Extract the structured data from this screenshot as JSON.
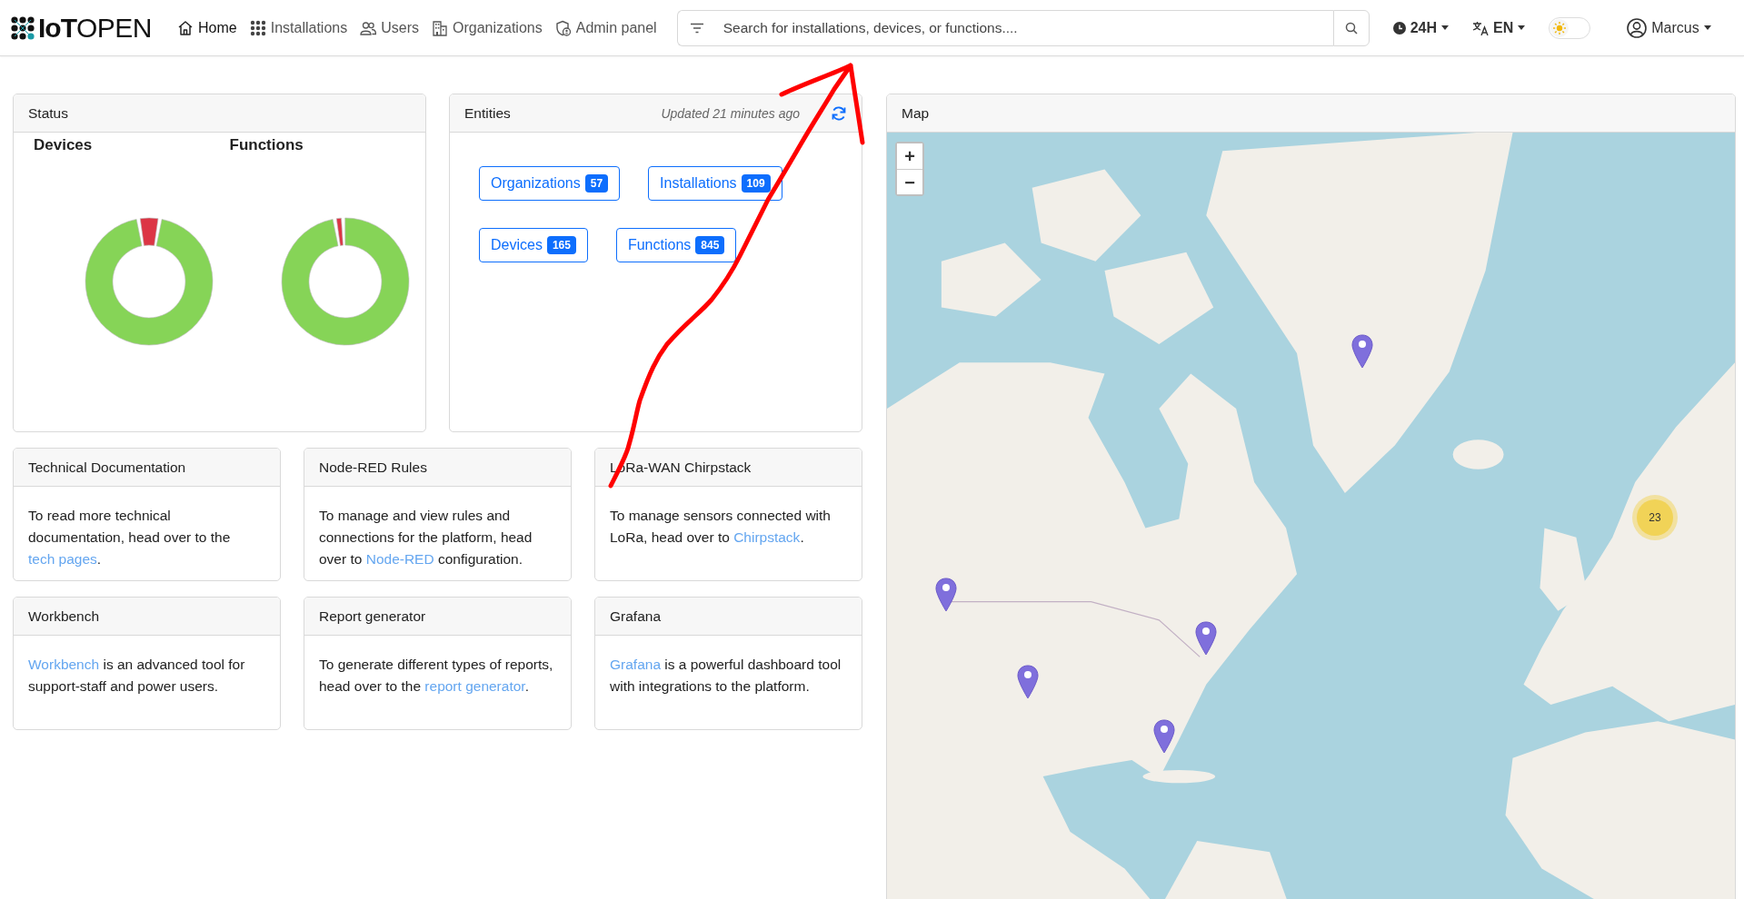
{
  "navbar": {
    "logo": "**IoT**OPEN",
    "nav_items": [
      {
        "label": "Home",
        "selected": true
      },
      {
        "label": "Installations",
        "selected": false
      },
      {
        "label": "Users",
        "selected": false
      },
      {
        "label": "Organizations",
        "selected": false
      },
      {
        "label": "Admin panel",
        "selected": false
      }
    ],
    "search": {
      "placeholder": "Search for installations, devices, or functions...."
    },
    "time_format": "24H",
    "language": "EN",
    "theme_toggle": {
      "on": false
    },
    "user": "Marcus"
  },
  "status": {
    "title": "Status",
    "charts": [
      {
        "title": "Devices"
      },
      {
        "title": "Functions"
      }
    ]
  },
  "entities": {
    "title": "Entities",
    "updated": "Updated 21 minutes ago",
    "buttons": [
      {
        "label": "Organizations",
        "count": "57"
      },
      {
        "label": "Installations",
        "count": "109"
      },
      {
        "label": "Devices",
        "count": "165"
      },
      {
        "label": "Functions",
        "count": "845"
      }
    ]
  },
  "info_cards": [
    {
      "title": "Technical Documentation",
      "body": [
        {
          "text": "To read more technical documentation, head over to the ",
          "link": false
        },
        {
          "text": "tech pages",
          "link": true
        },
        {
          "text": ".",
          "link": false
        }
      ]
    },
    {
      "title": "Node-RED Rules",
      "body": [
        {
          "text": "To manage and view rules and connections for the platform, head over to ",
          "link": false
        },
        {
          "text": "Node-RED",
          "link": true
        },
        {
          "text": " configuration.",
          "link": false
        }
      ]
    },
    {
      "title": "LoRa-WAN Chirpstack",
      "body": [
        {
          "text": "To manage sensors connected with LoRa, head over to ",
          "link": false
        },
        {
          "text": "Chirpstack",
          "link": true
        },
        {
          "text": ".",
          "link": false
        }
      ]
    },
    {
      "title": "Workbench",
      "body": [
        {
          "text": "Workbench",
          "link": true
        },
        {
          "text": " is an advanced tool for support-staff and power users.",
          "link": false
        }
      ]
    },
    {
      "title": "Report generator",
      "body": [
        {
          "text": "To generate different types of reports, head over to the ",
          "link": false
        },
        {
          "text": "report generator",
          "link": true
        },
        {
          "text": ".",
          "link": false
        }
      ]
    },
    {
      "title": "Grafana",
      "body": [
        {
          "text": "Grafana",
          "link": true
        },
        {
          "text": " is a powerful dashboard tool with integrations to the platform.",
          "link": false
        }
      ]
    }
  ],
  "map": {
    "title": "Map",
    "zoom_in": "+",
    "zoom_out": "−",
    "cluster_count": "23"
  }
}
